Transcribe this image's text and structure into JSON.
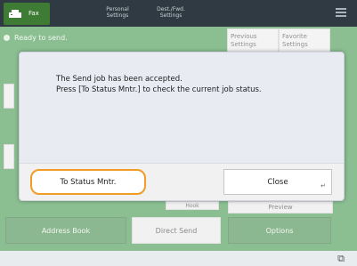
{
  "header": {
    "app_label": "Fax",
    "tabs": [
      {
        "label": "Personal\nSettings"
      },
      {
        "label": "Dest./Fwd.\nSettings"
      }
    ],
    "menu_icon": "menu-icon"
  },
  "status": {
    "text": "Ready to send."
  },
  "quick_buttons": {
    "previous": "Previous\nSettings",
    "favorite": "Favorite\nSettings"
  },
  "background": {
    "address_book": "Address Book",
    "direct_send": "Direct Send",
    "options": "Options",
    "preview": "Preview",
    "hook": "Hook"
  },
  "dialog": {
    "line1": "The Send job has been accepted.",
    "line2": "Press [To Status Mntr.] to check the current job status.",
    "status_button": "To Status Mntr.",
    "close_button": "Close"
  },
  "colors": {
    "header": "#2f3a42",
    "accent_green": "#2d8a3a",
    "focus_orange": "#f09c26"
  }
}
